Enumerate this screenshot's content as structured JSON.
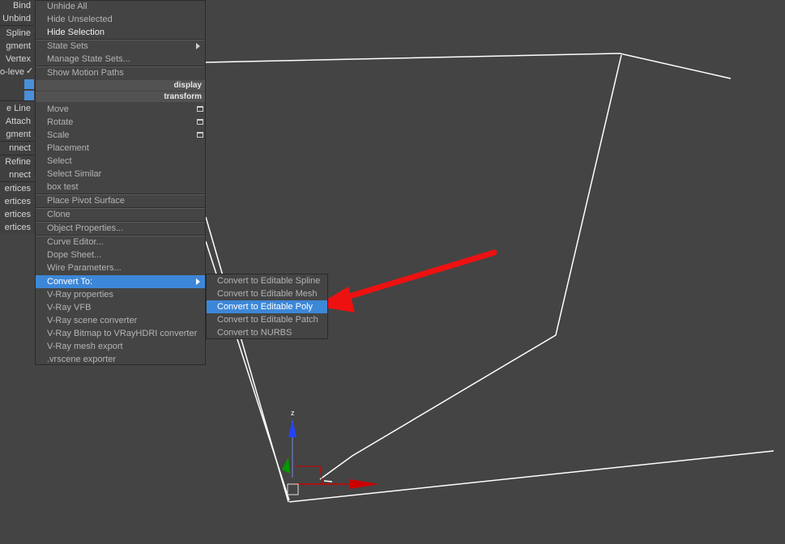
{
  "left_panel": {
    "rows": [
      "Bind",
      "Unbind",
      "Spline",
      "gment",
      "Vertex",
      "o-level",
      "e Line",
      "Attach",
      "gment",
      "nnect",
      "Refine",
      "nnect",
      "ertices",
      "ertices",
      "ertices",
      "ertices"
    ]
  },
  "quad_menu": {
    "display_label": "display",
    "transform_label": "transform",
    "items": {
      "unhide_all": "Unhide All",
      "hide_unselected": "Hide Unselected",
      "hide_selection": "Hide Selection",
      "state_sets": "State Sets",
      "manage_state_sets": "Manage State Sets...",
      "show_motion_paths": "Show Motion Paths",
      "move": "Move",
      "rotate": "Rotate",
      "scale": "Scale",
      "placement": "Placement",
      "select": "Select",
      "select_similar": "Select Similar",
      "box_test": "box test",
      "place_pivot_surface": "Place Pivot Surface",
      "clone": "Clone",
      "object_properties": "Object Properties...",
      "curve_editor": "Curve Editor...",
      "dope_sheet": "Dope Sheet...",
      "wire_parameters": "Wire Parameters...",
      "convert_to": "Convert To:",
      "vray_properties": "V-Ray properties",
      "vray_vfb": "V-Ray VFB",
      "vray_scene_converter": "V-Ray scene converter",
      "vray_bitmap_converter": "V-Ray Bitmap to VRayHDRI converter",
      "vray_mesh_export": "V-Ray mesh export",
      "vrscene_exporter": ".vrscene exporter"
    }
  },
  "convert_submenu": {
    "items": [
      "Convert to Editable Spline",
      "Convert to Editable Mesh",
      "Convert to Editable Poly",
      "Convert to Editable Patch",
      "Convert to NURBS"
    ],
    "highlighted": "Convert to Editable Poly"
  },
  "gizmo": {
    "z_label": "z"
  },
  "colors": {
    "viewport_bg": "#444444",
    "highlight": "#3d87d8",
    "annotation_arrow": "#ee1111",
    "axis_x": "#cc0000",
    "axis_y": "#00aa00",
    "axis_z": "#2244ff"
  }
}
